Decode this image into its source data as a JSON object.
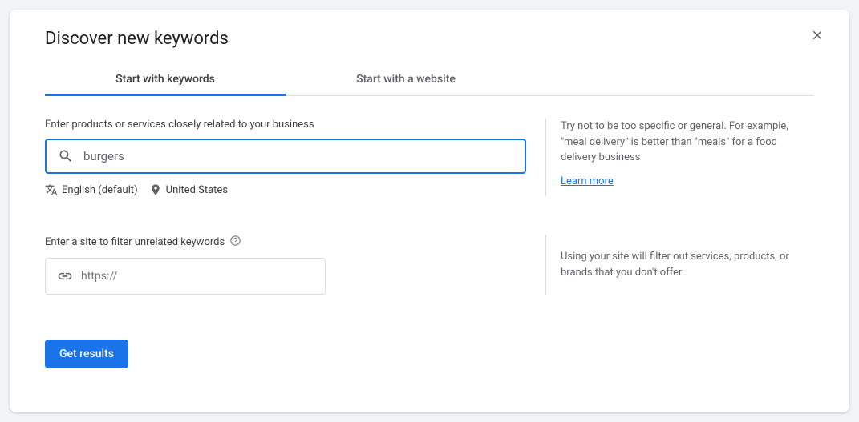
{
  "dialog": {
    "title": "Discover new keywords"
  },
  "tabs": [
    {
      "label": "Start with keywords",
      "active": true
    },
    {
      "label": "Start with a website",
      "active": false
    }
  ],
  "keywordSection": {
    "label": "Enter products or services closely related to your business",
    "inputValue": "burgers",
    "language": "English (default)",
    "location": "United States",
    "helpText": "Try not to be too specific or general. For example, \"meal delivery\" is better than \"meals\" for a food delivery business",
    "learnMore": "Learn more"
  },
  "siteSection": {
    "label": "Enter a site to filter unrelated keywords",
    "placeholder": "https://",
    "helpText": "Using your site will filter out services, products, or brands that you don't offer"
  },
  "actions": {
    "submit": "Get results"
  }
}
